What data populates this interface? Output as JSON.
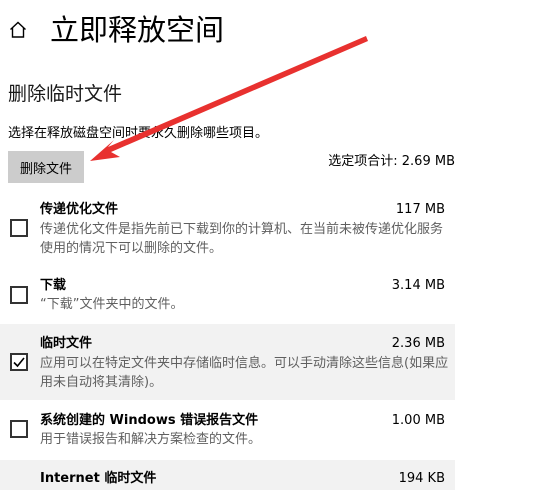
{
  "header": {
    "home_icon": "home-icon",
    "title": "立即释放空间"
  },
  "section": {
    "title": "删除临时文件",
    "instruction": "选择在释放磁盘空间时要永久删除哪些项目。",
    "delete_button": "删除文件",
    "total": "选定项合计: 2.69 MB"
  },
  "items": [
    {
      "name": "传递优化文件",
      "size": "117 MB",
      "desc": "传递优化文件是指先前已下载到你的计算机、在当前未被传递优化服务使用的情况下可以删除的文件。",
      "checked": false
    },
    {
      "name": "下载",
      "size": "3.14 MB",
      "desc": "“下载”文件夹中的文件。",
      "checked": false
    },
    {
      "name": "临时文件",
      "size": "2.36 MB",
      "desc": "应用可以在特定文件夹中存储临时信息。可以手动清除这些信息(如果应用未自动将其清除)。",
      "checked": true
    },
    {
      "name": "系统创建的 Windows 错误报告文件",
      "size": "1.00 MB",
      "desc": "用于错误报告和解决方案检查的文件。",
      "checked": false
    },
    {
      "name": "Internet 临时文件",
      "size": "194 KB",
      "desc": "",
      "checked": false
    }
  ],
  "annotation": {
    "arrow_color": "#e8312f"
  }
}
